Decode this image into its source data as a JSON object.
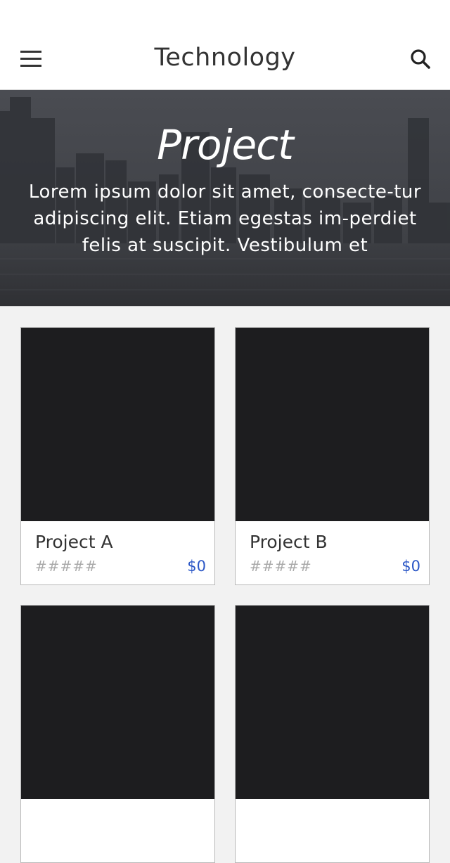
{
  "header": {
    "title": "Technology",
    "menu_icon": "hamburger-menu-icon",
    "search_icon": "search-icon"
  },
  "hero": {
    "title": "Project",
    "description": "Lorem ipsum dolor sit amet, consecte-tur adipiscing elit. Etiam egestas im-perdiet felis at suscipit. Vestibulum et"
  },
  "projects": [
    {
      "name": "Project A",
      "rating": "#####",
      "price": "$0"
    },
    {
      "name": "Project B",
      "rating": "#####",
      "price": "$0"
    },
    {
      "name": "",
      "rating": "",
      "price": ""
    },
    {
      "name": "",
      "rating": "",
      "price": ""
    }
  ],
  "colors": {
    "price": "#2a56c6",
    "thumbnail": "#1d1d1f",
    "background": "#f2f2f2"
  }
}
